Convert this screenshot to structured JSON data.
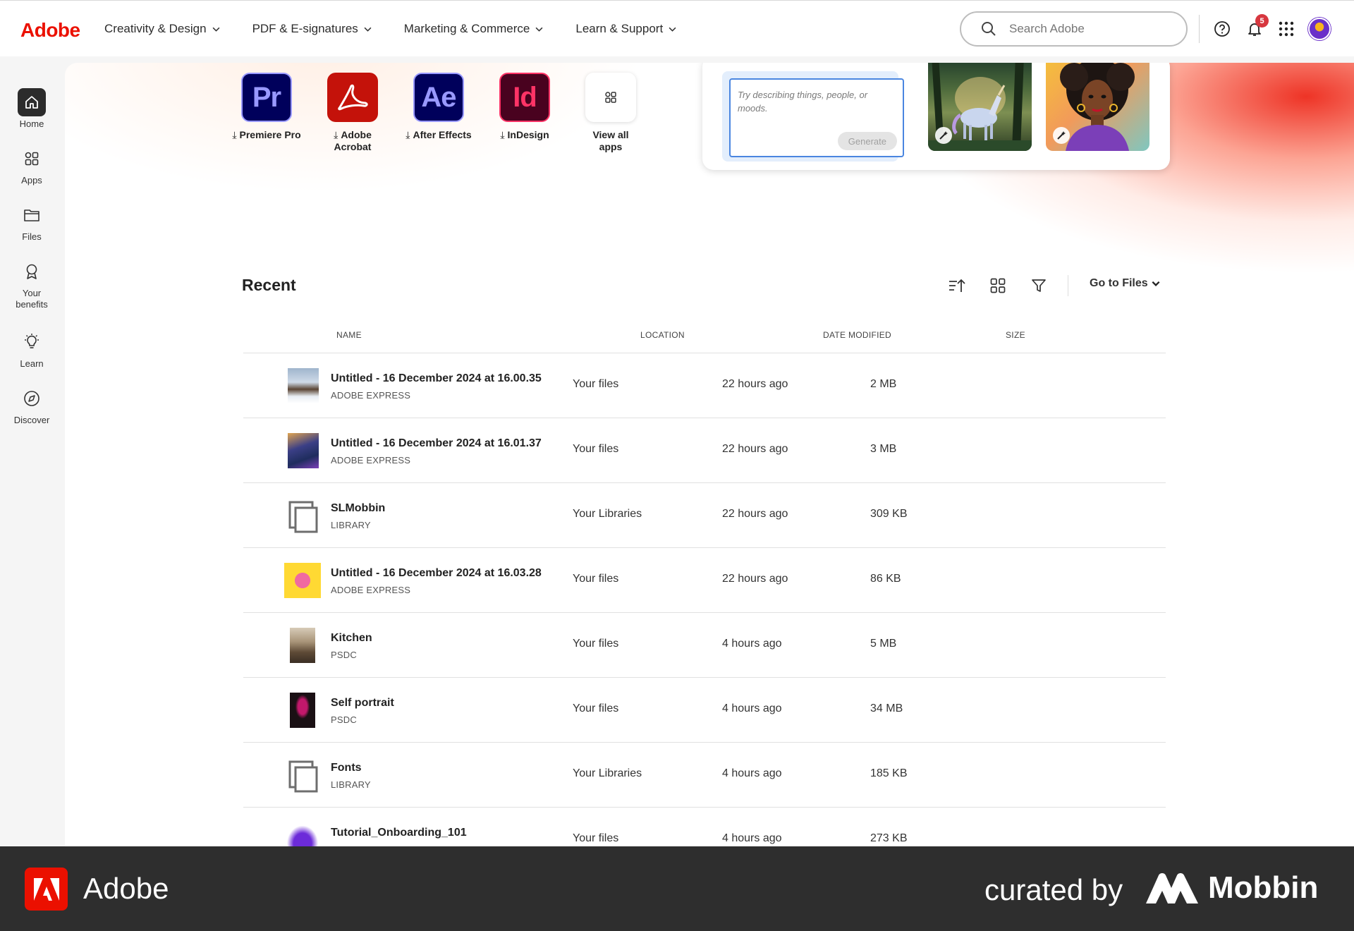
{
  "nav": {
    "logo": "Adobe",
    "menu": [
      "Creativity & Design",
      "PDF & E-signatures",
      "Marketing & Commerce",
      "Learn & Support"
    ],
    "search_placeholder": "Search Adobe",
    "notifications_count": "5"
  },
  "sidebar": {
    "items": [
      {
        "label": "Home",
        "icon": "home-icon"
      },
      {
        "label": "Apps",
        "icon": "apps-icon"
      },
      {
        "label": "Files",
        "icon": "folder-icon"
      },
      {
        "label": "Your benefits",
        "icon": "award-icon"
      },
      {
        "label": "Learn",
        "icon": "lightbulb-icon"
      },
      {
        "label": "Discover",
        "icon": "compass-icon"
      }
    ]
  },
  "apps": [
    {
      "abbr": "Pr",
      "name": "Premiere Pro",
      "bg": "#00005b",
      "fg": "#9999ff"
    },
    {
      "abbr": "",
      "name": "Adobe Acrobat",
      "bg": "#c4120a",
      "fg": "#ffffff"
    },
    {
      "abbr": "Ae",
      "name": "After Effects",
      "bg": "#00005b",
      "fg": "#9999ff"
    },
    {
      "abbr": "Id",
      "name": "InDesign",
      "bg": "#49021f",
      "fg": "#ff3366"
    },
    {
      "abbr": "",
      "name": "View all apps",
      "bg": "#ffffff",
      "fg": "#333333"
    }
  ],
  "firefly": {
    "prompt_placeholder": "Try describing things, people, or moods.",
    "generate_label": "Generate"
  },
  "recent": {
    "title": "Recent",
    "goto_label": "Go to Files",
    "columns": [
      "NAME",
      "LOCATION",
      "DATE MODIFIED",
      "SIZE"
    ],
    "rows": [
      {
        "name": "Untitled - 16 December 2024 at 16.00.35",
        "type": "ADOBE EXPRESS",
        "location": "Your files",
        "date": "22 hours ago",
        "size": "2 MB",
        "thumb": "winter-cabin"
      },
      {
        "name": "Untitled - 16 December 2024 at 16.01.37",
        "type": "ADOBE EXPRESS",
        "location": "Your files",
        "date": "22 hours ago",
        "size": "3 MB",
        "thumb": "unicorn"
      },
      {
        "name": "SLMobbin",
        "type": "LIBRARY",
        "location": "Your Libraries",
        "date": "22 hours ago",
        "size": "309 KB",
        "thumb": "library"
      },
      {
        "name": "Untitled - 16 December 2024 at 16.03.28",
        "type": "ADOBE EXPRESS",
        "location": "Your files",
        "date": "22 hours ago",
        "size": "86 KB",
        "thumb": "good-things"
      },
      {
        "name": "Kitchen",
        "type": "PSDC",
        "location": "Your files",
        "date": "4 hours ago",
        "size": "5 MB",
        "thumb": "kitchen"
      },
      {
        "name": "Self portrait",
        "type": "PSDC",
        "location": "Your files",
        "date": "4 hours ago",
        "size": "34 MB",
        "thumb": "portrait"
      },
      {
        "name": "Fonts",
        "type": "LIBRARY",
        "location": "Your Libraries",
        "date": "4 hours ago",
        "size": "185 KB",
        "thumb": "library"
      },
      {
        "name": "Tutorial_Onboarding_101",
        "type": "",
        "location": "Your files",
        "date": "4 hours ago",
        "size": "273 KB",
        "thumb": "tutorial"
      }
    ]
  },
  "footer": {
    "brand": "Adobe",
    "curated": "curated by",
    "mobbin": "Mobbin"
  }
}
